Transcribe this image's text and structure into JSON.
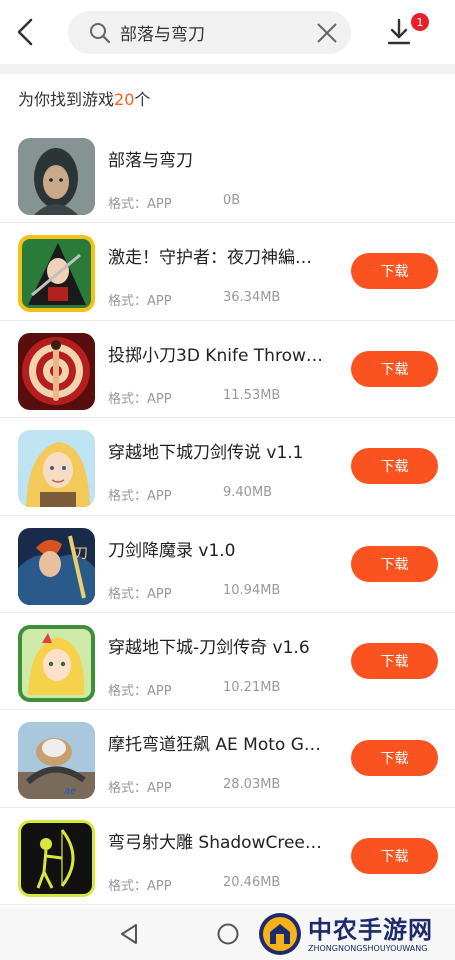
{
  "header": {
    "search_value": "部落与弯刀",
    "download_badge": "1"
  },
  "summary": {
    "prefix": "为你找到游戏",
    "count": "20",
    "suffix": "个"
  },
  "meta_label": "格式：APP",
  "apps": [
    {
      "name": "部落与弯刀",
      "format": "格式：APP",
      "size": "0B",
      "button": "",
      "icon": "tribe-icon"
    },
    {
      "name": "激走！守护者：夜刀神編…",
      "format": "格式：APP",
      "size": "36.34MB",
      "button": "下载",
      "icon": "ninja-icon"
    },
    {
      "name": "投掷小刀3D Knife Throw…",
      "format": "格式：APP",
      "size": "11.53MB",
      "button": "下载",
      "icon": "target-icon"
    },
    {
      "name": "穿越地下城刀剑传说  v1.1",
      "format": "格式：APP",
      "size": "9.40MB",
      "button": "下载",
      "icon": "blonde-warrior-icon"
    },
    {
      "name": "刀剑降魔录  v1.0",
      "format": "格式：APP",
      "size": "10.94MB",
      "button": "下载",
      "icon": "swordsman-icon"
    },
    {
      "name": "穿越地下城-刀剑传奇  v1.6",
      "format": "格式：APP",
      "size": "10.21MB",
      "button": "下载",
      "icon": "anime-girl-icon"
    },
    {
      "name": "摩托弯道狂飙 AE Moto G…",
      "format": "格式：APP",
      "size": "28.03MB",
      "button": "下载",
      "icon": "moto-rider-icon"
    },
    {
      "name": "弯弓射大雕 ShadowCree…",
      "format": "格式：APP",
      "size": "20.46MB",
      "button": "下载",
      "icon": "shadow-archer-icon"
    }
  ],
  "watermark": {
    "title": "中农手游网",
    "subtitle": "ZHONGNONGSHOUYOUWANG"
  }
}
